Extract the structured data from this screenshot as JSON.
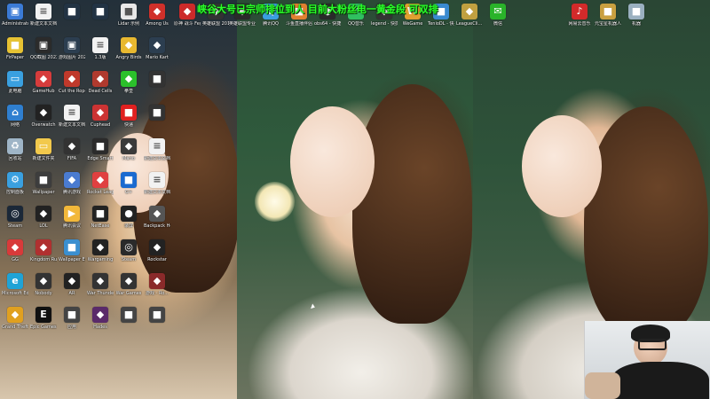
{
  "banner": {
    "text": "峡谷大号已宗师排位到人 目前大粉丝电一黄金段 可双排"
  },
  "desktop_icons": {
    "col1": [
      {
        "label": "Administrator",
        "icon": "user-folder-icon",
        "color": "#3b7bd6"
      },
      {
        "label": "FirPaper",
        "icon": "app-icon",
        "color": "#e6c233"
      },
      {
        "label": "此电脑",
        "icon": "computer-icon",
        "color": "#3aa0e0"
      },
      {
        "label": "网络",
        "icon": "network-icon",
        "color": "#2f7fd0"
      },
      {
        "label": "回收站",
        "icon": "recycle-bin-icon",
        "color": "#9fb5c7"
      },
      {
        "label": "控制面板",
        "icon": "control-panel-icon",
        "color": "#3aa0e0"
      },
      {
        "label": "Steam",
        "icon": "steam-icon",
        "color": "#1b2838"
      },
      {
        "label": "GG",
        "icon": "game-icon",
        "color": "#d83a3a"
      },
      {
        "label": "Microsoft Edge",
        "icon": "edge-icon",
        "color": "#1fa3d6"
      },
      {
        "label": "Grand Theft Auto V",
        "icon": "game-icon",
        "color": "#e0a020"
      }
    ],
    "col2": [
      {
        "label": "新建文本文档",
        "icon": "document-icon",
        "color": "#f2f2f2"
      },
      {
        "label": "QQ截图 20220413",
        "icon": "image-icon",
        "color": "#2b2b2b"
      },
      {
        "label": "GameHub",
        "icon": "game-icon",
        "color": "#d63c3c"
      },
      {
        "label": "Overwatch",
        "icon": "game-icon",
        "color": "#222222"
      },
      {
        "label": "新建文件夹",
        "icon": "folder-icon",
        "color": "#f2c94c"
      },
      {
        "label": "Wallpaper",
        "icon": "app-icon",
        "color": "#3d3d3d"
      },
      {
        "label": "LOL",
        "icon": "game-icon",
        "color": "#222222"
      },
      {
        "label": "Kingdom Rush",
        "icon": "game-icon",
        "color": "#b03030"
      },
      {
        "label": "Nobody",
        "icon": "game-icon",
        "color": "#333333"
      },
      {
        "label": "Epic Games Launcher",
        "icon": "epic-icon",
        "color": "#111111"
      }
    ],
    "col3": [
      {
        "label": "",
        "icon": "app-icon",
        "color": "#223344"
      },
      {
        "label": "游戏图片 2022-02",
        "icon": "image-icon",
        "color": "#2c3e50"
      },
      {
        "label": "Cut the Rope",
        "icon": "game-icon",
        "color": "#c0392b"
      },
      {
        "label": "新建文本文档",
        "icon": "document-icon",
        "color": "#f2f2f2"
      },
      {
        "label": "FIFA",
        "icon": "game-icon",
        "color": "#333333"
      },
      {
        "label": "腾讯游戏",
        "icon": "game-icon",
        "color": "#4a7bd0"
      },
      {
        "label": "腾讯会议",
        "icon": "meeting-icon",
        "color": "#f2b83a"
      },
      {
        "label": "Wallpaper Engine",
        "icon": "app-icon",
        "color": "#3a8fd0"
      },
      {
        "label": "AR",
        "icon": "game-icon",
        "color": "#222222"
      },
      {
        "label": "应用",
        "icon": "app-icon",
        "color": "#444444"
      }
    ],
    "col4": [
      {
        "label": "",
        "icon": "app-icon",
        "color": "#223344"
      },
      {
        "label": "1.3版",
        "icon": "document-icon",
        "color": "#f2f2f2"
      },
      {
        "label": "Dead Cells",
        "icon": "game-icon",
        "color": "#b03a2e"
      },
      {
        "label": "Cuphead",
        "icon": "game-icon",
        "color": "#cc3333"
      },
      {
        "label": "Edge Smart",
        "icon": "app-icon",
        "color": "#2b2b2b"
      },
      {
        "label": "Rocket League",
        "icon": "game-icon",
        "color": "#e04040"
      },
      {
        "label": "NetEase",
        "icon": "app-icon",
        "color": "#222222"
      },
      {
        "label": "Wargaming",
        "icon": "game-icon",
        "color": "#222222"
      },
      {
        "label": "War Thunder",
        "icon": "game-icon",
        "color": "#333333"
      },
      {
        "label": "Hades",
        "icon": "game-icon",
        "color": "#5a2a6a"
      }
    ],
    "col5": [
      {
        "label": "Lidar 示例",
        "icon": "app-icon",
        "color": "#e8e8e8"
      },
      {
        "label": "Angry Birds",
        "icon": "game-icon",
        "color": "#e8b830"
      },
      {
        "label": "拳皇",
        "icon": "game-icon",
        "color": "#2bc02b"
      },
      {
        "label": "快递",
        "icon": "app-icon",
        "color": "#e02020"
      },
      {
        "label": "Mario",
        "icon": "game-icon",
        "color": "#3a3a3a"
      },
      {
        "label": "G+",
        "icon": "app-icon",
        "color": "#1a6ad0"
      },
      {
        "label": "录屏",
        "icon": "record-icon",
        "color": "#222222"
      },
      {
        "label": "Steam",
        "icon": "steam-icon",
        "color": "#2a2a2a"
      },
      {
        "label": "War Games",
        "icon": "game-icon",
        "color": "#333333"
      },
      {
        "label": "",
        "icon": "app-icon",
        "color": "#444444"
      }
    ],
    "col6": [
      {
        "label": "Among Us",
        "icon": "game-icon",
        "color": "#d0302a"
      },
      {
        "label": "Mario Kart",
        "icon": "game-icon",
        "color": "#2c3e50"
      },
      {
        "label": "",
        "icon": "app-icon",
        "color": "#333333"
      },
      {
        "label": "",
        "icon": "app-icon",
        "color": "#333333"
      },
      {
        "label": "新建文本文档",
        "icon": "document-icon",
        "color": "#f2f2f2"
      },
      {
        "label": "新建文本文档",
        "icon": "document-icon",
        "color": "#f2f2f2"
      },
      {
        "label": "Backpack Hero Demo",
        "icon": "game-icon",
        "color": "#555555"
      },
      {
        "label": "Rockstar",
        "icon": "game-icon",
        "color": "#222222"
      },
      {
        "label": "游戏 - Ro...",
        "icon": "game-icon",
        "color": "#8a2a2a"
      },
      {
        "label": "",
        "icon": "app-icon",
        "color": "#444444"
      }
    ],
    "top_row": [
      {
        "label": "原神 战斗 Fegun",
        "icon": "game-icon",
        "color": "#cc2a2a"
      },
      {
        "label": "英雄联盟 2010",
        "icon": "game-icon",
        "color": "#333333"
      },
      {
        "label": "英雄联盟专业版",
        "icon": "game-icon",
        "color": "#2a2a2a"
      },
      {
        "label": "腾讯QQ",
        "icon": "qq-icon",
        "color": "#3a9fe0"
      },
      {
        "label": "斗鱼直播伴侣",
        "icon": "app-icon",
        "color": "#e08030"
      },
      {
        "label": "obs64 - 快捷方式",
        "icon": "obs-icon",
        "color": "#2a2a2a"
      },
      {
        "label": "QQ音乐",
        "icon": "music-icon",
        "color": "#30c060"
      },
      {
        "label": "legend - 快捷方式",
        "icon": "game-icon",
        "color": "#333333"
      },
      {
        "label": "WeGame",
        "icon": "wegame-icon",
        "color": "#e0a030"
      },
      {
        "label": "TenioDL - 快捷方式",
        "icon": "app-icon",
        "color": "#3a8ad0"
      },
      {
        "label": "LeagueCli... 快捷方式",
        "icon": "game-icon",
        "color": "#c0a040"
      },
      {
        "label": "微信",
        "icon": "wechat-icon",
        "color": "#2ab32a"
      },
      {
        "label": "网易云音乐",
        "icon": "music-icon",
        "color": "#d22a2a"
      },
      {
        "label": "元宝星机器人",
        "icon": "app-icon",
        "color": "#c9a040"
      },
      {
        "label": "机器",
        "icon": "app-icon",
        "color": "#9ab0c0"
      }
    ]
  }
}
